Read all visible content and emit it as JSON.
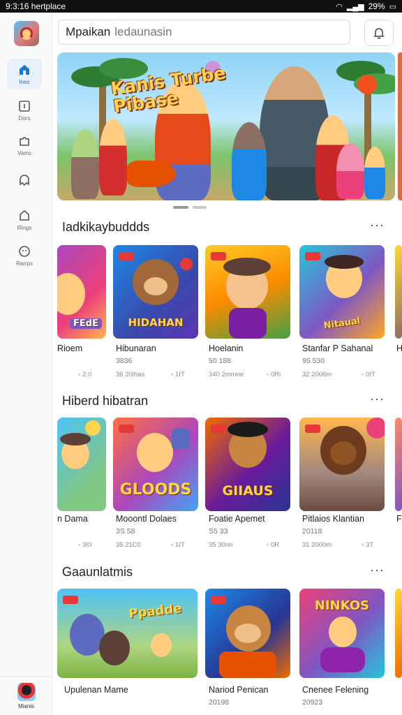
{
  "status_bar": {
    "time": "9:3:16",
    "carrier": "hertplace",
    "battery": "29%"
  },
  "sidebar": {
    "items": [
      {
        "label": "Ines",
        "icon": "home-icon"
      },
      {
        "label": "Dors",
        "icon": "tablet-icon"
      },
      {
        "label": "Vams",
        "icon": "puzzle-icon"
      },
      {
        "label": "",
        "icon": "ghost-icon"
      },
      {
        "label": "Rings",
        "icon": "bag-icon"
      },
      {
        "label": "Rarrps",
        "icon": "gamepad-icon"
      }
    ],
    "profile_label": "Mianis"
  },
  "search": {
    "query": "Mpaikan",
    "placeholder": "ledaunasin"
  },
  "hero": {
    "title_line1": "Kanis Turbe",
    "title_line2": "Pibase"
  },
  "sections": [
    {
      "title": "Iadkikaybuddds",
      "games": [
        {
          "title": "Rioem",
          "sub": "",
          "meta1": "2.0",
          "meta2": "",
          "card_label": "FEdE"
        },
        {
          "title": "Hibunaran",
          "sub": "3836",
          "meta1": "36 20lhas",
          "meta2": "1IT",
          "card_label": "HIDAHAN"
        },
        {
          "title": "Hoelanin",
          "sub": "50 188",
          "meta1": "340 2mmne",
          "meta2": "0Ri",
          "card_label": ""
        },
        {
          "title": "Stanfar P Sahanal",
          "sub": "95 530",
          "meta1": "32 2006m",
          "meta2": "0IT",
          "card_label": "Nitaual"
        },
        {
          "title": "H",
          "sub": "",
          "meta1": "",
          "meta2": "",
          "card_label": ""
        }
      ]
    },
    {
      "title": "Hiberd hibatran",
      "games": [
        {
          "title": "n Dama",
          "sub": "",
          "meta1": "3I0",
          "meta2": "",
          "card_label": ""
        },
        {
          "title": "Mooontl Dolaes",
          "sub": "3S 58",
          "meta1": "35 21C0",
          "meta2": "1IT",
          "card_label": "GLOODS"
        },
        {
          "title": "Foatie Apemet",
          "sub": "S5 33",
          "meta1": "35 30nn",
          "meta2": "0R",
          "card_label": "GIIAUS"
        },
        {
          "title": "Pitlaios Klantian",
          "sub": "20118",
          "meta1": "31 2000m",
          "meta2": "3T",
          "card_label": ""
        },
        {
          "title": "F",
          "sub": "",
          "meta1": "",
          "meta2": "",
          "card_label": ""
        }
      ]
    },
    {
      "title": "Gaaunlatmis",
      "games": [
        {
          "title": "Upulenan Mame",
          "sub": "",
          "meta1": "",
          "meta2": "",
          "card_label": "Ppadde"
        },
        {
          "title": "Nariod Penican",
          "sub": "20198",
          "meta1": "",
          "meta2": "",
          "card_label": ""
        },
        {
          "title": "Cnenee Felening",
          "sub": "20923",
          "meta1": "",
          "meta2": "",
          "card_label": "NINKOS"
        }
      ]
    }
  ],
  "colors": {
    "accent": "#1976d2",
    "badge": "#e53935"
  }
}
